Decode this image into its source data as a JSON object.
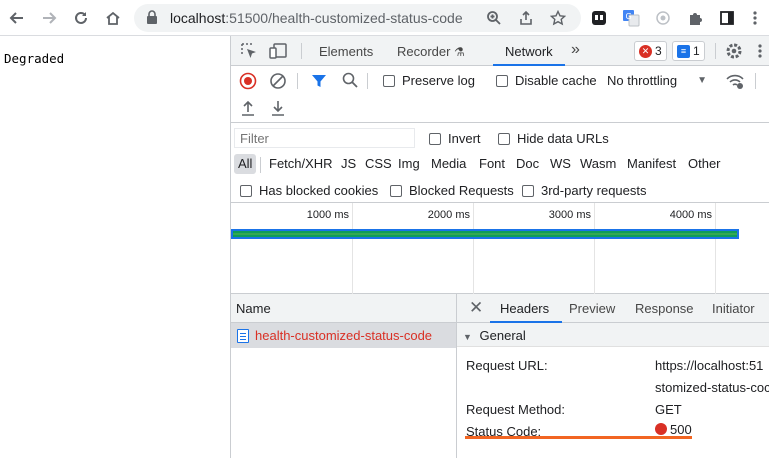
{
  "browser": {
    "url_host": "localhost",
    "url_rest": ":51500/health-customized-status-code",
    "nav_icons": [
      "back-icon",
      "forward-icon",
      "reload-icon",
      "home-icon"
    ]
  },
  "page": {
    "body_text": "Degraded"
  },
  "devtools": {
    "tabs": [
      "Elements",
      "Recorder",
      "Network"
    ],
    "active_tab": "Network",
    "error_count": "3",
    "message_count": "1",
    "toolbar": {
      "preserve_log": "Preserve log",
      "disable_cache": "Disable cache",
      "throttling": "No throttling"
    },
    "filter": {
      "placeholder": "Filter",
      "invert": "Invert",
      "hide_data_urls": "Hide data URLs"
    },
    "types": [
      "All",
      "Fetch/XHR",
      "JS",
      "CSS",
      "Img",
      "Media",
      "Font",
      "Doc",
      "WS",
      "Wasm",
      "Manifest",
      "Other"
    ],
    "selected_type": "All",
    "options": {
      "blocked_cookies": "Has blocked cookies",
      "blocked_requests": "Blocked Requests",
      "third_party": "3rd-party requests"
    },
    "timeline": {
      "ticks": [
        "1000 ms",
        "2000 ms",
        "3000 ms",
        "4000 ms"
      ]
    },
    "requests": {
      "column_header": "Name",
      "rows": [
        {
          "name": "health-customized-status-code",
          "status": "error"
        }
      ]
    },
    "details": {
      "tabs": [
        "Headers",
        "Preview",
        "Response",
        "Initiator"
      ],
      "active_tab": "Headers",
      "section": "General",
      "fields": {
        "request_url_label": "Request URL:",
        "request_url_value_line1": "https://localhost:51",
        "request_url_value_line2": "stomized-status-coc",
        "request_method_label": "Request Method:",
        "request_method_value": "GET",
        "status_code_label": "Status Code:",
        "status_code_value": "500"
      }
    }
  },
  "colors": {
    "error_red": "#d93025",
    "accent_blue": "#1a73e8",
    "highlight_orange": "#f26522",
    "timeline_green": "#0f9d58"
  }
}
